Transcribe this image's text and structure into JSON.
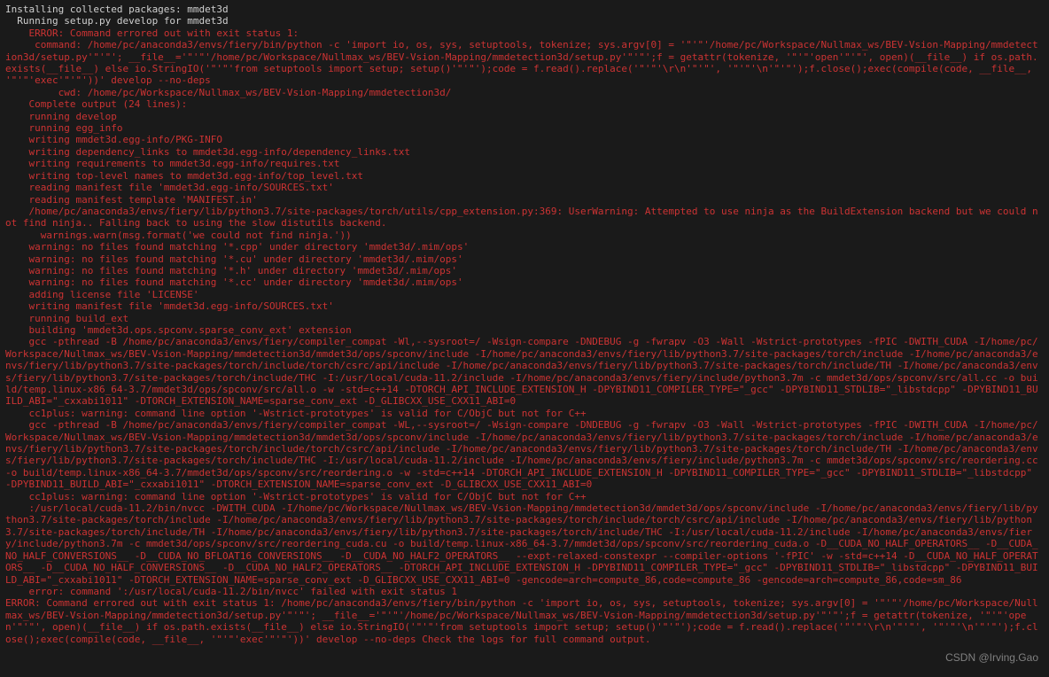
{
  "terminal": {
    "lines": [
      {
        "cls": "white",
        "text": "Installing collected packages: mmdet3d"
      },
      {
        "cls": "white",
        "text": "  Running setup.py develop for mmdet3d"
      },
      {
        "cls": "red",
        "text": "    ERROR: Command errored out with exit status 1:"
      },
      {
        "cls": "red",
        "text": "     command: /home/pc/anaconda3/envs/fiery/bin/python -c 'import io, os, sys, setuptools, tokenize; sys.argv[0] = '\"'\"'/home/pc/Workspace/Nullmax_ws/BEV-Vsion-Mapping/mmdetection3d/setup.py'\"'\"'; __file__='\"'\"'/home/pc/Workspace/Nullmax_ws/BEV-Vsion-Mapping/mmdetection3d/setup.py'\"'\"';f = getattr(tokenize, '\"'\"'open'\"'\"', open)(__file__) if os.path.exists(__file__) else io.StringIO('\"'\"'from setuptools import setup; setup()'\"'\"');code = f.read().replace('\"'\"'\\r\\n'\"'\"', '\"'\"'\\n'\"'\"');f.close();exec(compile(code, __file__, '\"'\"'exec'\"'\"'))' develop --no-deps"
      },
      {
        "cls": "red",
        "text": "         cwd: /home/pc/Workspace/Nullmax_ws/BEV-Vsion-Mapping/mmdetection3d/"
      },
      {
        "cls": "red",
        "text": "    Complete output (24 lines):"
      },
      {
        "cls": "red",
        "text": "    running develop"
      },
      {
        "cls": "red",
        "text": "    running egg_info"
      },
      {
        "cls": "red",
        "text": "    writing mmdet3d.egg-info/PKG-INFO"
      },
      {
        "cls": "red",
        "text": "    writing dependency_links to mmdet3d.egg-info/dependency_links.txt"
      },
      {
        "cls": "red",
        "text": "    writing requirements to mmdet3d.egg-info/requires.txt"
      },
      {
        "cls": "red",
        "text": "    writing top-level names to mmdet3d.egg-info/top_level.txt"
      },
      {
        "cls": "red",
        "text": "    reading manifest file 'mmdet3d.egg-info/SOURCES.txt'"
      },
      {
        "cls": "red",
        "text": "    reading manifest template 'MANIFEST.in'"
      },
      {
        "cls": "red",
        "text": "    /home/pc/anaconda3/envs/fiery/lib/python3.7/site-packages/torch/utils/cpp_extension.py:369: UserWarning: Attempted to use ninja as the BuildExtension backend but we could not find ninja.. Falling back to using the slow distutils backend."
      },
      {
        "cls": "red",
        "text": "      warnings.warn(msg.format('we could not find ninja.'))"
      },
      {
        "cls": "red",
        "text": "    warning: no files found matching '*.cpp' under directory 'mmdet3d/.mim/ops'"
      },
      {
        "cls": "red",
        "text": "    warning: no files found matching '*.cu' under directory 'mmdet3d/.mim/ops'"
      },
      {
        "cls": "red",
        "text": "    warning: no files found matching '*.h' under directory 'mmdet3d/.mim/ops'"
      },
      {
        "cls": "red",
        "text": "    warning: no files found matching '*.cc' under directory 'mmdet3d/.mim/ops'"
      },
      {
        "cls": "red",
        "text": "    adding license file 'LICENSE'"
      },
      {
        "cls": "red",
        "text": "    writing manifest file 'mmdet3d.egg-info/SOURCES.txt'"
      },
      {
        "cls": "red",
        "text": "    running build_ext"
      },
      {
        "cls": "red",
        "text": "    building 'mmdet3d.ops.spconv.sparse_conv_ext' extension"
      },
      {
        "cls": "red",
        "text": "    gcc -pthread -B /home/pc/anaconda3/envs/fiery/compiler_compat -Wl,--sysroot=/ -Wsign-compare -DNDEBUG -g -fwrapv -O3 -Wall -Wstrict-prototypes -fPIC -DWITH_CUDA -I/home/pc/Workspace/Nullmax_ws/BEV-Vsion-Mapping/mmdetection3d/mmdet3d/ops/spconv/include -I/home/pc/anaconda3/envs/fiery/lib/python3.7/site-packages/torch/include -I/home/pc/anaconda3/envs/fiery/lib/python3.7/site-packages/torch/include/torch/csrc/api/include -I/home/pc/anaconda3/envs/fiery/lib/python3.7/site-packages/torch/include/TH -I/home/pc/anaconda3/envs/fiery/lib/python3.7/site-packages/torch/include/THC -I:/usr/local/cuda-11.2/include -I/home/pc/anaconda3/envs/fiery/include/python3.7m -c mmdet3d/ops/spconv/src/all.cc -o build/temp.linux-x86_64-3.7/mmdet3d/ops/spconv/src/all.o -w -std=c++14 -DTORCH_API_INCLUDE_EXTENSION_H -DPYBIND11_COMPILER_TYPE=\"_gcc\" -DPYBIND11_STDLIB=\"_libstdcpp\" -DPYBIND11_BUILD_ABI=\"_cxxabi1011\" -DTORCH_EXTENSION_NAME=sparse_conv_ext -D_GLIBCXX_USE_CXX11_ABI=0"
      },
      {
        "cls": "red",
        "text": "    cc1plus: warning: command line option '-Wstrict-prototypes' is valid for C/ObjC but not for C++"
      },
      {
        "cls": "red",
        "text": "    gcc -pthread -B /home/pc/anaconda3/envs/fiery/compiler_compat -WL,--sysroot=/ -Wsign-compare -DNDEBUG -g -fwrapv -O3 -Wall -Wstrict-prototypes -fPIC -DWITH_CUDA -I/home/pc/Workspace/Nullmax_ws/BEV-Vsion-Mapping/mmdetection3d/mmdet3d/ops/spconv/include -I/home/pc/anaconda3/envs/fiery/lib/python3.7/site-packages/torch/include -I/home/pc/anaconda3/envs/fiery/lib/python3.7/site-packages/torch/include/torch/csrc/api/include -I/home/pc/anaconda3/envs/fiery/lib/python3.7/site-packages/torch/include/TH -I/home/pc/anaconda3/envs/fiery/lib/python3.7/site-packages/torch/include/THC -I:/usr/local/cuda-11.2/include -I/home/pc/anaconda3/envs/fiery/include/python3.7m -c mmdet3d/ops/spconv/src/reordering.cc -o build/temp.linux-x86_64-3.7/mmdet3d/ops/spconv/src/reordering.o -w -std=c++14 -DTORCH_API_INCLUDE_EXTENSION_H -DPYBIND11_COMPILER_TYPE=\"_gcc\" -DPYBIND11_STDLIB=\"_libstdcpp\" -DPYBIND11_BUILD_ABI=\"_cxxabi1011\" -DTORCH_EXTENSION_NAME=sparse_conv_ext -D_GLIBCXX_USE_CXX11_ABI=0"
      },
      {
        "cls": "red",
        "text": "    cc1plus: warning: command line option '-Wstrict-prototypes' is valid for C/ObjC but not for C++"
      },
      {
        "cls": "red",
        "text": "    :/usr/local/cuda-11.2/bin/nvcc -DWITH_CUDA -I/home/pc/Workspace/Nullmax_ws/BEV-Vsion-Mapping/mmdetection3d/mmdet3d/ops/spconv/include -I/home/pc/anaconda3/envs/fiery/lib/python3.7/site-packages/torch/include -I/home/pc/anaconda3/envs/fiery/lib/python3.7/site-packages/torch/include/torch/csrc/api/include -I/home/pc/anaconda3/envs/fiery/lib/python3.7/site-packages/torch/include/TH -I/home/pc/anaconda3/envs/fiery/lib/python3.7/site-packages/torch/include/THC -I:/usr/local/cuda-11.2/include -I/home/pc/anaconda3/envs/fiery/include/python3.7m -c mmdet3d/ops/spconv/src/reordering_cuda.cu -o build/temp.linux-x86_64-3.7/mmdet3d/ops/spconv/src/reordering_cuda.o -D__CUDA_NO_HALF_OPERATORS__ -D__CUDA_NO_HALF_CONVERSIONS__ -D__CUDA_NO_BFLOAT16_CONVERSIONS__ -D__CUDA_NO_HALF2_OPERATORS__ --expt-relaxed-constexpr --compiler-options '-fPIC' -w -std=c++14 -D__CUDA_NO_HALF_OPERATORS__ -D__CUDA_NO_HALF_CONVERSIONS__ -D__CUDA_NO_HALF2_OPERATORS__ -DTORCH_API_INCLUDE_EXTENSION_H -DPYBIND11_COMPILER_TYPE=\"_gcc\" -DPYBIND11_STDLIB=\"_libstdcpp\" -DPYBIND11_BUILD_ABI=\"_cxxabi1011\" -DTORCH_EXTENSION_NAME=sparse_conv_ext -D_GLIBCXX_USE_CXX11_ABI=0 -gencode=arch=compute_86,code=compute_86 -gencode=arch=compute_86,code=sm_86"
      },
      {
        "cls": "red",
        "text": "    error: command ':/usr/local/cuda-11.2/bin/nvcc' failed with exit status 1"
      },
      {
        "cls": "red",
        "text": ""
      },
      {
        "cls": "red",
        "text": "ERROR: Command errored out with exit status 1: /home/pc/anaconda3/envs/fiery/bin/python -c 'import io, os, sys, setuptools, tokenize; sys.argv[0] = '\"'\"'/home/pc/Workspace/Nullmax_ws/BEV-Vsion-Mapping/mmdetection3d/setup.py'\"'\"'; __file__='\"'\"'/home/pc/Workspace/Nullmax_ws/BEV-Vsion-Mapping/mmdetection3d/setup.py'\"'\"';f = getattr(tokenize, '\"'\"'open'\"'\"', open)(__file__) if os.path.exists(__file__) else io.StringIO('\"'\"'from setuptools import setup; setup()'\"'\"');code = f.read().replace('\"'\"'\\r\\n'\"'\"', '\"'\"'\\n'\"'\"');f.close();exec(compile(code, __file__, '\"'\"'exec'\"'\"'))' develop --no-deps Check the logs for full command output."
      }
    ]
  },
  "watermark": "CSDN @Irving.Gao"
}
